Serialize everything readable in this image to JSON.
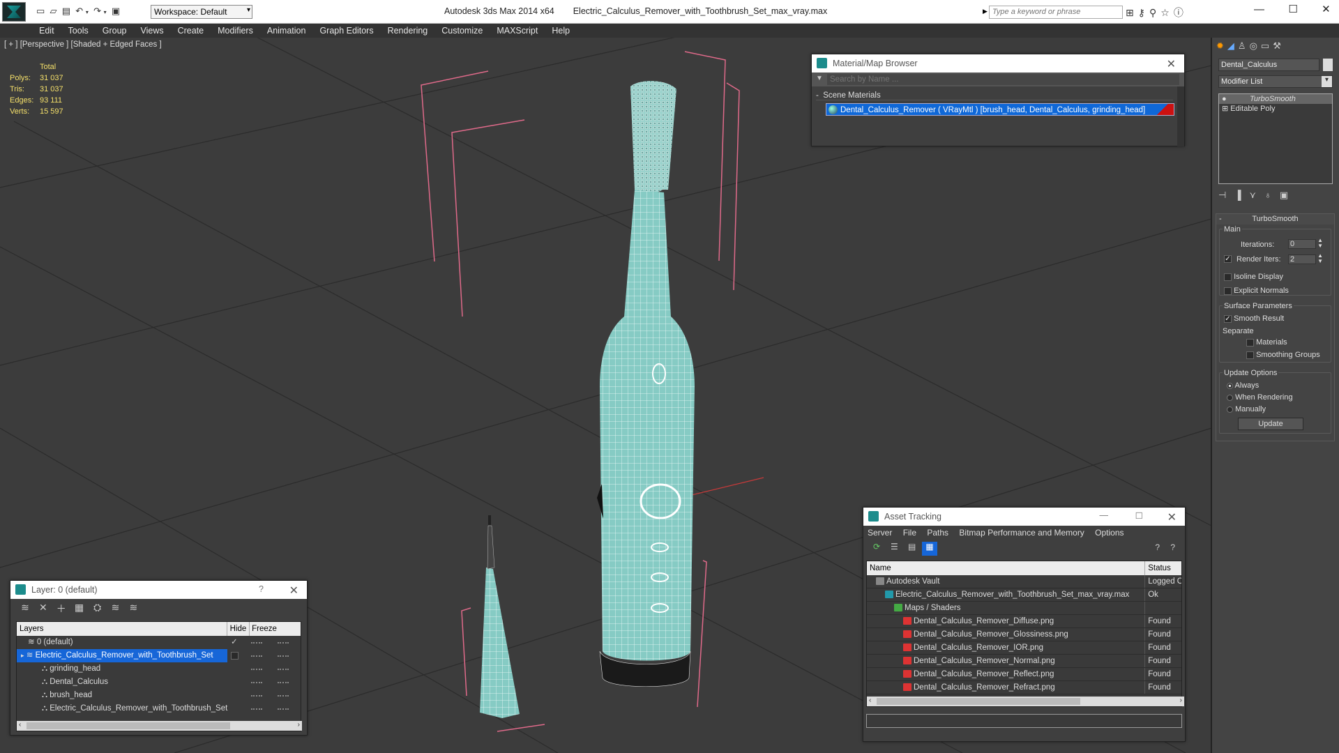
{
  "titlebar": {
    "app_title": "Autodesk 3ds Max  2014 x64",
    "file_title": "Electric_Calculus_Remover_with_Toothbrush_Set_max_vray.max",
    "workspace": "Workspace: Default",
    "search_placeholder": "Type a keyword or phrase"
  },
  "menu": [
    "Edit",
    "Tools",
    "Group",
    "Views",
    "Create",
    "Modifiers",
    "Animation",
    "Graph Editors",
    "Rendering",
    "Customize",
    "MAXScript",
    "Help"
  ],
  "viewport": {
    "label": "[ + ] [Perspective ] [Shaded + Edged Faces ]",
    "stats": {
      "header": "Total",
      "rows": [
        {
          "label": "Polys:",
          "value": "31 037"
        },
        {
          "label": "Tris:",
          "value": "31 037"
        },
        {
          "label": "Edges:",
          "value": "93 111"
        },
        {
          "label": "Verts:",
          "value": "15 597"
        }
      ]
    }
  },
  "material_browser": {
    "title": "Material/Map Browser",
    "search_placeholder": "Search by Name ...",
    "group": "Scene Materials",
    "item": "Dental_Calculus_Remover  ( VRayMtl ) [brush_head, Dental_Calculus, grinding_head]",
    "swatch_color": "#cc1111"
  },
  "layers": {
    "title": "Layer: 0 (default)",
    "help": "?",
    "columns": {
      "layers": "Layers",
      "hide": "Hide",
      "freeze": "Freeze"
    },
    "rows": [
      {
        "name": "0 (default)",
        "indent": 0
      },
      {
        "name": "Electric_Calculus_Remover_with_Toothbrush_Set",
        "indent": 0
      },
      {
        "name": "grinding_head",
        "indent": 1
      },
      {
        "name": "Dental_Calculus",
        "indent": 1
      },
      {
        "name": "brush_head",
        "indent": 1
      },
      {
        "name": "Electric_Calculus_Remover_with_Toothbrush_Set",
        "indent": 1
      }
    ]
  },
  "assets": {
    "title": "Asset Tracking",
    "menu": [
      "Server",
      "File",
      "Paths",
      "Bitmap Performance and Memory",
      "Options"
    ],
    "columns": {
      "name": "Name",
      "status": "Status"
    },
    "rows": [
      {
        "name": "Autodesk Vault",
        "status": "Logged O",
        "indent": 1,
        "icon": "vault-icon"
      },
      {
        "name": "Electric_Calculus_Remover_with_Toothbrush_Set_max_vray.max",
        "status": "Ok",
        "indent": 2,
        "icon": "max-file-icon"
      },
      {
        "name": "Maps / Shaders",
        "status": "",
        "indent": 3,
        "icon": "maps-icon"
      },
      {
        "name": "Dental_Calculus_Remover_Diffuse.png",
        "status": "Found",
        "indent": 4,
        "icon": "png-icon"
      },
      {
        "name": "Dental_Calculus_Remover_Glossiness.png",
        "status": "Found",
        "indent": 4,
        "icon": "png-icon"
      },
      {
        "name": "Dental_Calculus_Remover_IOR.png",
        "status": "Found",
        "indent": 4,
        "icon": "png-icon"
      },
      {
        "name": "Dental_Calculus_Remover_Normal.png",
        "status": "Found",
        "indent": 4,
        "icon": "png-icon"
      },
      {
        "name": "Dental_Calculus_Remover_Reflect.png",
        "status": "Found",
        "indent": 4,
        "icon": "png-icon"
      },
      {
        "name": "Dental_Calculus_Remover_Refract.png",
        "status": "Found",
        "indent": 4,
        "icon": "png-icon"
      }
    ]
  },
  "command_panel": {
    "object_name": "Dental_Calculus",
    "modifier_list": "Modifier List",
    "stack": [
      "TurboSmooth",
      "Editable Poly"
    ],
    "rollout_title": "TurboSmooth",
    "main_label": "Main",
    "iterations_label": "Iterations:",
    "iterations_value": "0",
    "render_iters_label": "Render Iters:",
    "render_iters_value": "2",
    "isoline": "Isoline Display",
    "explicit": "Explicit Normals",
    "surface_label": "Surface Parameters",
    "smooth_result": "Smooth Result",
    "separate_label": "Separate",
    "materials": "Materials",
    "smoothing_groups": "Smoothing Groups",
    "update_options": "Update Options",
    "always": "Always",
    "when_rendering": "When Rendering",
    "manually": "Manually",
    "update_button": "Update"
  }
}
